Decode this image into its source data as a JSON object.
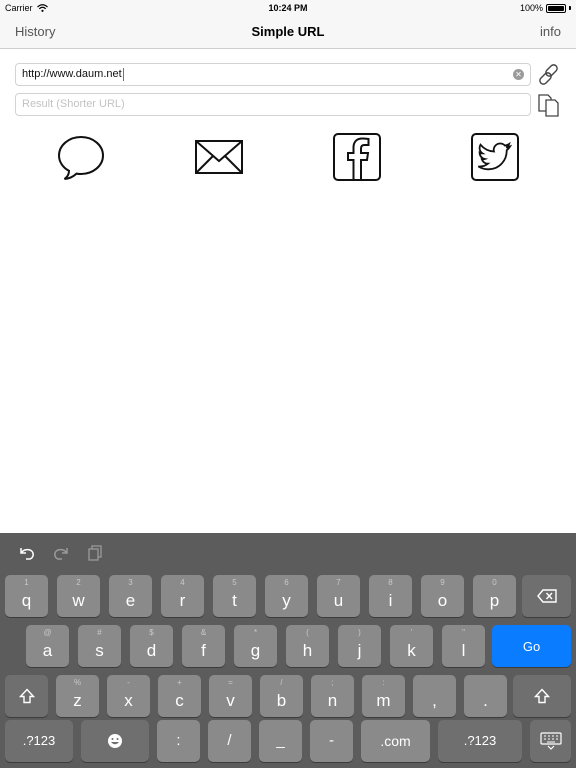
{
  "status_bar": {
    "carrier": "Carrier",
    "time": "10:24 PM",
    "battery": "100%",
    "battery_level": 1.0
  },
  "nav": {
    "left": "History",
    "title": "Simple URL",
    "right": "info"
  },
  "url_input": {
    "value": "http://www.daum.net"
  },
  "result_input": {
    "placeholder": "Result (Shorter URL)"
  },
  "share_icons": [
    "message-icon",
    "mail-icon",
    "facebook-icon",
    "twitter-icon"
  ],
  "keyboard": {
    "row1": [
      {
        "hint": "1",
        "key": "q"
      },
      {
        "hint": "2",
        "key": "w"
      },
      {
        "hint": "3",
        "key": "e"
      },
      {
        "hint": "4",
        "key": "r"
      },
      {
        "hint": "5",
        "key": "t"
      },
      {
        "hint": "6",
        "key": "y"
      },
      {
        "hint": "7",
        "key": "u"
      },
      {
        "hint": "8",
        "key": "i"
      },
      {
        "hint": "9",
        "key": "o"
      },
      {
        "hint": "0",
        "key": "p"
      }
    ],
    "row2": [
      {
        "hint": "@",
        "key": "a"
      },
      {
        "hint": "#",
        "key": "s"
      },
      {
        "hint": "$",
        "key": "d"
      },
      {
        "hint": "&",
        "key": "f"
      },
      {
        "hint": "*",
        "key": "g"
      },
      {
        "hint": "(",
        "key": "h"
      },
      {
        "hint": ")",
        "key": "j"
      },
      {
        "hint": "'",
        "key": "k"
      },
      {
        "hint": "\"",
        "key": "l"
      }
    ],
    "go": "Go",
    "row3": [
      {
        "hint": "%",
        "key": "z"
      },
      {
        "hint": "-",
        "key": "x"
      },
      {
        "hint": "+",
        "key": "c"
      },
      {
        "hint": "=",
        "key": "v"
      },
      {
        "hint": "/",
        "key": "b"
      },
      {
        "hint": ";",
        "key": "n"
      },
      {
        "hint": ":",
        "key": "m"
      },
      {
        "hint": "",
        "key": ","
      },
      {
        "hint": "",
        "key": "."
      }
    ],
    "row4": {
      "numbers": ".?123",
      "colon": ":",
      "slash": "/",
      "underscore": "_",
      "dash": "-",
      "dotcom": ".com",
      "numbers_right": ".?123"
    }
  },
  "colors": {
    "accent": "#0a7cff",
    "keyboard_bg": "#5c5c5c",
    "key": "#8a8a8a",
    "key_dark": "#6f6f6f"
  }
}
